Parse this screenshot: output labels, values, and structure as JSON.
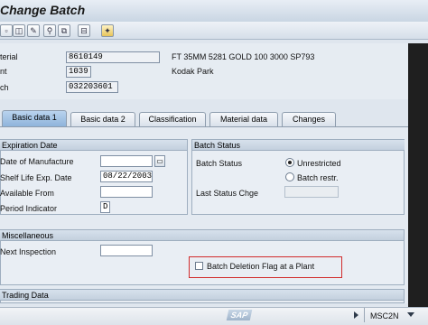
{
  "window": {
    "title": "Change Batch"
  },
  "header": {
    "material_label": "terial",
    "material_value": "8610149",
    "material_desc": "FT 35MM 5281 GOLD 100    3000 SP793",
    "plant_label": "nt",
    "plant_value": "1039",
    "plant_desc": "Kodak Park",
    "batch_label": "ch",
    "batch_value": "032203601"
  },
  "tabs": [
    "Basic data 1",
    "Basic data 2",
    "Classification",
    "Material data",
    "Changes"
  ],
  "expiration": {
    "title": "Expiration Date",
    "date_of_manufacture": {
      "label": "Date of Manufacture",
      "value": ""
    },
    "shelf_life_exp_date": {
      "label": "Shelf Life Exp. Date",
      "value": "08/22/2003"
    },
    "available_from": {
      "label": "Available From",
      "value": ""
    },
    "period_indicator": {
      "label": "Period Indicator",
      "value": "D"
    }
  },
  "batch_status": {
    "title": "Batch Status",
    "label": "Batch Status",
    "unrestricted": "Unrestricted",
    "restricted": "Batch restr.",
    "last_status_change_label": "Last Status Chge",
    "last_status_change_value": ""
  },
  "miscellaneous": {
    "title": "Miscellaneous",
    "next_inspection_label": "Next Inspection",
    "next_inspection_value": "",
    "deletion_flag_label": "Batch Deletion Flag at a Plant"
  },
  "trading": {
    "title": "Trading Data"
  },
  "statusbar": {
    "sap_logo": "SAP",
    "transaction": "MSC2N"
  },
  "icons": [
    "document-icon",
    "display-icon",
    "edit-icon",
    "classification-icon",
    "copy-icon",
    "delete-icon",
    "where-used-icon"
  ]
}
